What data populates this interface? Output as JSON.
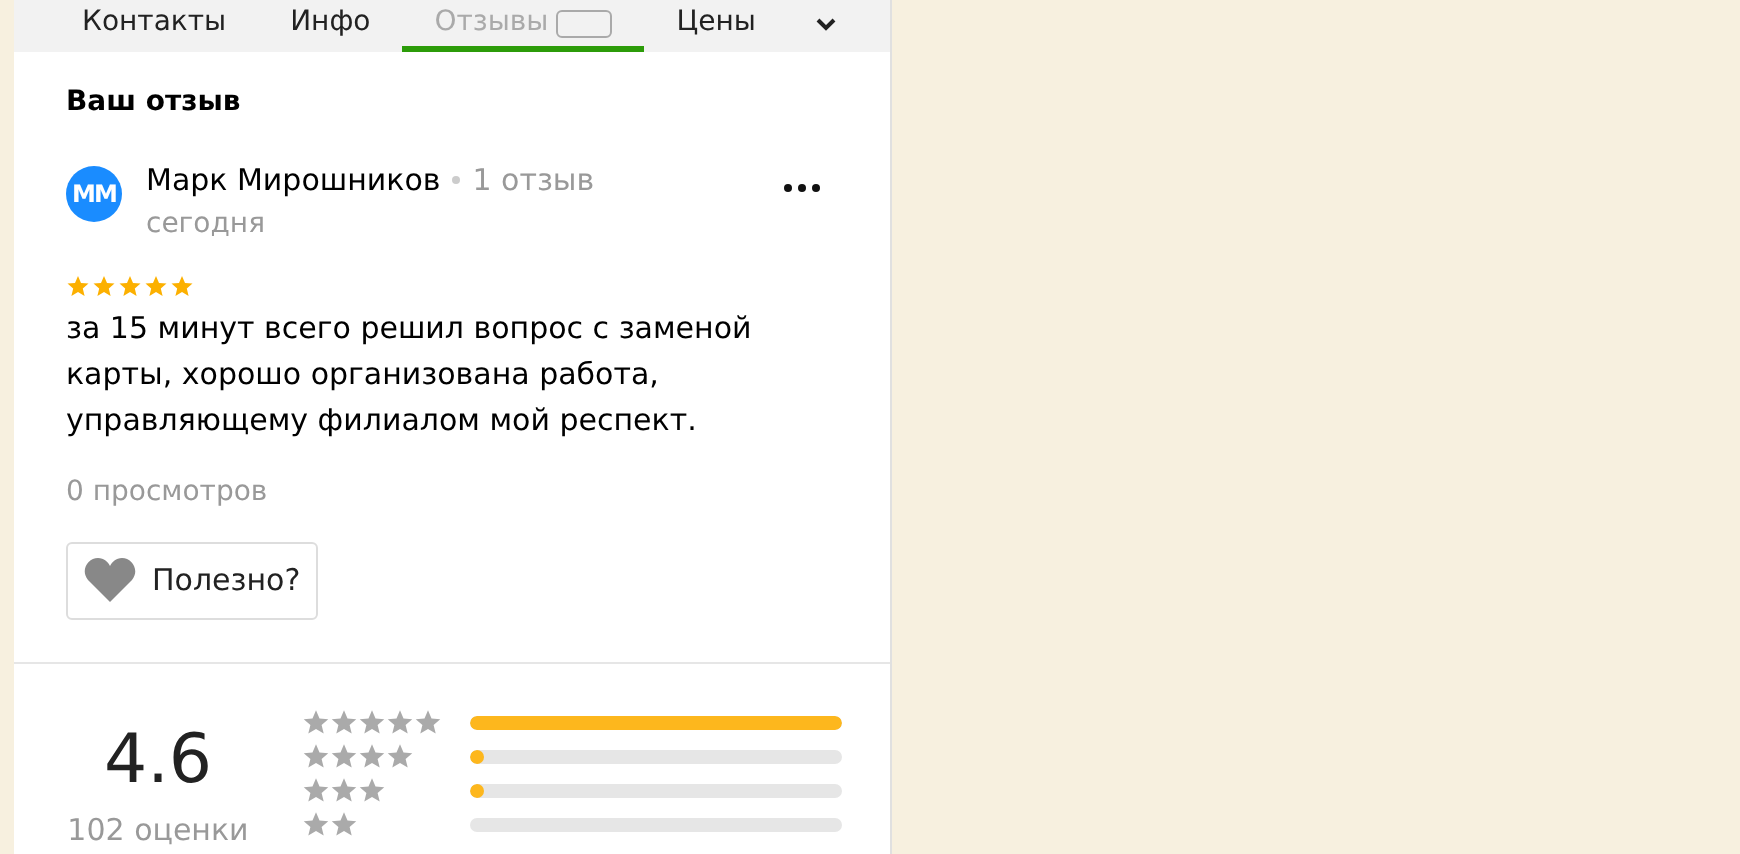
{
  "tabs": [
    {
      "label": "Контакты",
      "selected": false
    },
    {
      "label": "Инфо",
      "selected": false
    },
    {
      "label": "Отзывы",
      "selected": true,
      "badge": true
    },
    {
      "label": "Цены",
      "selected": false
    }
  ],
  "section_title": "Ваш отзыв",
  "review": {
    "avatar": "ММ",
    "author": "Марк Мирошников",
    "author_reviews": "1 отзыв",
    "date": "сегодня",
    "stars": 5,
    "text": "за 15 минут всего решил вопрос с заменой карты, хорошо организована работа, управляющему филиалом мой респект.",
    "views": "0 просмотров",
    "helpful_button": "Полезно?"
  },
  "rating": {
    "score": "4.6",
    "count": "102 оценки",
    "breakdown": [
      {
        "kind": "five",
        "level": 1.0
      },
      {
        "kind": "four",
        "level": 0.03
      },
      {
        "kind": "three",
        "level": 0.03
      },
      {
        "kind": "two",
        "level": 0
      }
    ]
  }
}
